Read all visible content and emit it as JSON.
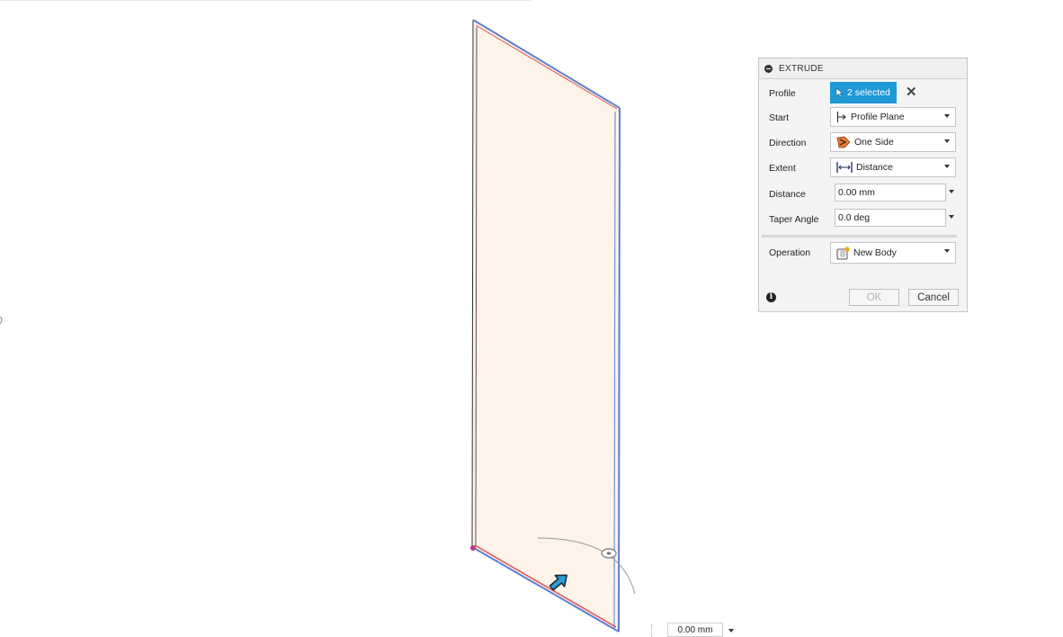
{
  "dialog": {
    "title": "EXTRUDE",
    "profile": {
      "label": "Profile",
      "value": "2 selected"
    },
    "start": {
      "label": "Start",
      "value": "Profile Plane",
      "icon": "profile-plane-icon"
    },
    "direction": {
      "label": "Direction",
      "value": "One Side",
      "icon": "one-side-icon"
    },
    "extent": {
      "label": "Extent",
      "value": "Distance",
      "icon": "distance-icon"
    },
    "distance": {
      "label": "Distance",
      "value": "0.00 mm"
    },
    "taper": {
      "label": "Taper Angle",
      "value": "0.0 deg"
    },
    "operation": {
      "label": "Operation",
      "value": "New Body",
      "icon": "new-body-icon"
    },
    "ok_label": "OK",
    "cancel_label": "Cancel"
  },
  "viewport": {
    "distance_input": "0.00 mm"
  },
  "colors": {
    "accent": "#1f9ad6",
    "face_fill": "#fdf3e8",
    "edge_blue": "#5b7fd6",
    "edge_red": "#e0504e",
    "manipulator_arrow": "#2aa0d4"
  }
}
